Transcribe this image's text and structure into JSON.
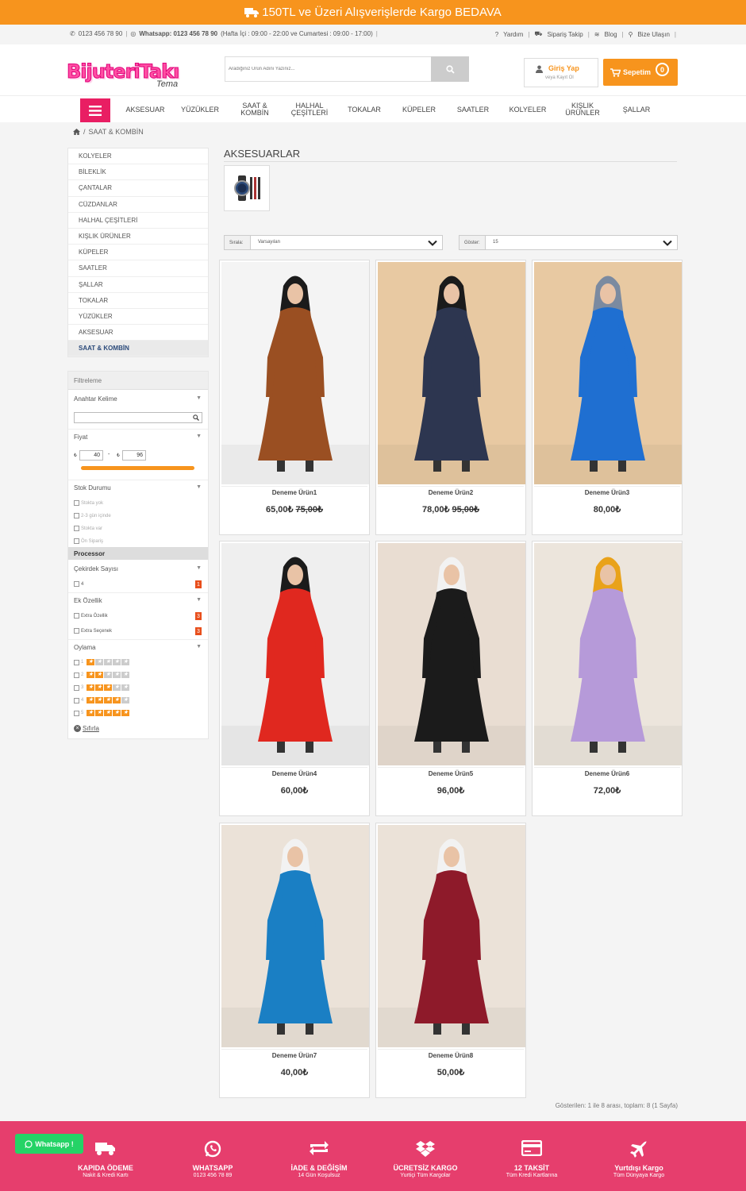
{
  "banner": {
    "text": "150TL ve Üzeri Alışverişlerde Kargo BEDAVA"
  },
  "infobar": {
    "phone": "0123 456 78 90",
    "whatsapp_label": "Whatsapp: 0123 456 78 90",
    "hours": "(Hafta İçi : 09:00 - 22:00 ve Cumartesi : 09:00 - 17:00)",
    "links": [
      "Yardım",
      "Sipariş Takip",
      "Blog",
      "Bize Ulaşın"
    ]
  },
  "header": {
    "logo_text": "BijuteriTakı",
    "logo_sub": "Tema",
    "search_placeholder": "Aradığınız Ürün Adını Yazınız...",
    "login_title": "Giriş Yap",
    "login_sub": "veya Kayıt Ol",
    "cart_label": "Sepetim",
    "cart_count": "0"
  },
  "nav": {
    "items": [
      "AKSESUAR",
      "YÜZÜKLER",
      "SAAT & KOMBİN",
      "HALHAL ÇEŞİTLERİ",
      "TOKALAR",
      "KÜPELER",
      "SAATLER",
      "KOLYELER",
      "KIŞLIK ÜRÜNLER",
      "ŞALLAR"
    ]
  },
  "breadcrumb": {
    "current": "SAAT & KOMBİN"
  },
  "categories": [
    "KOLYELER",
    "BİLEKLİK",
    "ÇANTALAR",
    "CÜZDANLAR",
    "HALHAL ÇEŞİTLERİ",
    "KIŞLIK ÜRÜNLER",
    "KÜPELER",
    "SAATLER",
    "ŞALLAR",
    "TOKALAR",
    "YÜZÜKLER",
    "AKSESUAR",
    "SAAT & KOMBİN"
  ],
  "filter": {
    "title": "Filtreleme",
    "keyword_label": "Anahtar Kelime",
    "price_label": "Fiyat",
    "price_min": "40",
    "price_max": "96",
    "currency": "₺",
    "price_sep": "-",
    "stock_label": "Stok Durumu",
    "stock_options": [
      "Stokta yok",
      "2-3 gün içinde",
      "Stokta var",
      "Ön Sipariş"
    ],
    "processor_label": "Processor",
    "core_label": "Çekirdek Sayısı",
    "core_options": [
      {
        "label": "4",
        "count": "1"
      }
    ],
    "extra_label": "Ek Özellik",
    "extra_options": [
      {
        "label": "Extra Özellik",
        "count": "3"
      },
      {
        "label": "Extra Seçenek",
        "count": "3"
      }
    ],
    "rating_label": "Oylama",
    "ratings": [
      "1",
      "2",
      "3",
      "4",
      "5"
    ],
    "reset_label": "Sıfırla"
  },
  "main": {
    "title": "AKSESUARLAR",
    "sort_label": "Sırala:",
    "sort_value": "Varsayılan",
    "show_label": "Göster:",
    "show_value": "15",
    "page_info": "Gösterilen: 1 ile 8 arası, toplam: 8 (1 Sayfa)"
  },
  "products": [
    {
      "name": "Deneme Ürün1",
      "price": "65,00₺",
      "old_price": "75,00₺",
      "dress": "#9a4f22",
      "scarf": "#1b1b1b",
      "bg": "#f4f4f4"
    },
    {
      "name": "Deneme Ürün2",
      "price": "78,00₺",
      "old_price": "95,00₺",
      "dress": "#2d3650",
      "scarf": "#1b1b1b",
      "bg": "#e8c9a2"
    },
    {
      "name": "Deneme Ürün3",
      "price": "80,00₺",
      "old_price": "",
      "dress": "#1f6fd1",
      "scarf": "#7b8aa0",
      "bg": "#e8c9a2"
    },
    {
      "name": "Deneme Ürün4",
      "price": "60,00₺",
      "old_price": "",
      "dress": "#e0281f",
      "scarf": "#1b1b1b",
      "bg": "#efefef"
    },
    {
      "name": "Deneme Ürün5",
      "price": "96,00₺",
      "old_price": "",
      "dress": "#1b1b1b",
      "scarf": "#f2f2f2",
      "bg": "#e9ddd2"
    },
    {
      "name": "Deneme Ürün6",
      "price": "72,00₺",
      "old_price": "",
      "dress": "#b69ad9",
      "scarf": "#e9a21a",
      "bg": "#ece5dc"
    },
    {
      "name": "Deneme Ürün7",
      "price": "40,00₺",
      "old_price": "",
      "dress": "#1a7fc4",
      "scarf": "#f2f2f2",
      "bg": "#ebe2d8"
    },
    {
      "name": "Deneme Ürün8",
      "price": "50,00₺",
      "old_price": "",
      "dress": "#8e1a2a",
      "scarf": "#f2f2f2",
      "bg": "#ebe2d8"
    }
  ],
  "footer": {
    "items": [
      {
        "title": "KAPIDA ÖDEME",
        "sub": "Nakit & Kredi Kartı",
        "icon": "truck-icon"
      },
      {
        "title": "WHATSAPP",
        "sub": "0123 456 78 89",
        "icon": "whatsapp-icon"
      },
      {
        "title": "İADE & DEĞİŞİM",
        "sub": "14 Gün Koşulsuz",
        "icon": "exchange-icon"
      },
      {
        "title": "ÜCRETSİZ KARGO",
        "sub": "Yurtiçi Tüm Kargolar",
        "icon": "box-icon"
      },
      {
        "title": "12 TAKSİT",
        "sub": "Tüm Kredi Kartlarına",
        "icon": "credit-card-icon"
      },
      {
        "title": "Yurtdışı Kargo",
        "sub": "Tüm Dünyaya Kargo",
        "icon": "plane-icon"
      }
    ],
    "whatsapp_button": "Whatsapp !"
  },
  "colors": {
    "accent": "#f7941d",
    "pink": "#e91e63",
    "footer": "#e63e6d",
    "whatsapp": "#25d366"
  }
}
